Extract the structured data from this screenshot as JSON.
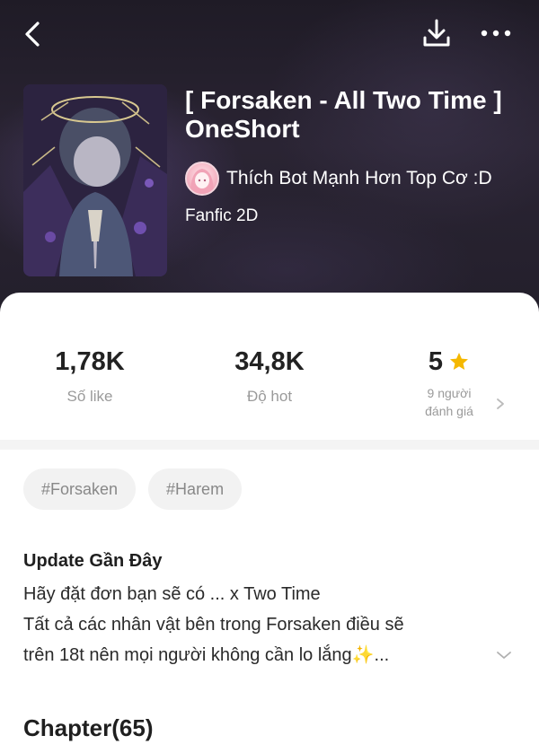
{
  "header": {
    "title": "[ Forsaken - All Two Time ] OneShort",
    "author": "Thích Bot Mạnh Hơn Top Cơ :D",
    "genre": "Fanfic 2D"
  },
  "icons": {
    "back": "back-arrow-icon",
    "download": "download-icon",
    "more": "more-dots-icon",
    "star": "star-icon",
    "chevron_right": "chevron-right-icon",
    "chevron_down": "chevron-down-icon"
  },
  "stats": {
    "likes_value": "1,78K",
    "likes_label": "Số like",
    "hot_value": "34,8K",
    "hot_label": "Độ hot",
    "rating_value": "5",
    "rating_label_1": "9 người",
    "rating_label_2": "đánh giá"
  },
  "tags": [
    "#Forsaken",
    "#Harem"
  ],
  "update": {
    "title": "Update Gần Đây",
    "lines": [
      "Hãy đặt đơn bạn sẽ có ... x Two Time",
      "Tất cả các nhân vật bên trong Forsaken điều sẽ",
      "trên 18t nên mọi người không cần lo lắng✨..."
    ]
  },
  "chapter_heading": "Chapter(65)",
  "colors": {
    "star": "#f5b800",
    "hero_bg": "#241f2c",
    "tag_bg": "#f2f2f2"
  }
}
